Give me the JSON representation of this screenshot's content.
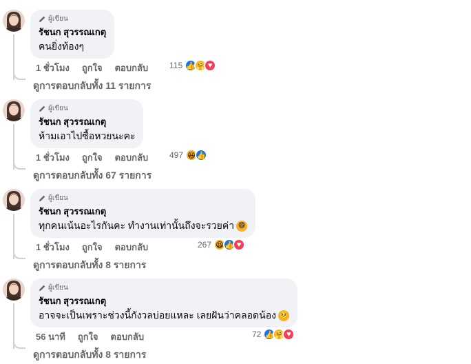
{
  "author_badge": "ผู้เขียน",
  "author_name": "รัชนก สุวรรณเกตุ",
  "like_label": "ถูกใจ",
  "reply_label": "ตอบกลับ",
  "comments": [
    {
      "text": "คนยิ่งท้องๆ",
      "time": "1 ชั่วโมง",
      "reaction_count": "115",
      "reactions": [
        "like-icon",
        "care-icon",
        "love-icon"
      ],
      "view_replies": "ดูการตอบกลับทั้ง 11 รายการ",
      "trailing_emoji": ""
    },
    {
      "text": "ห้ามเอาไปซื้อหวยนะคะ",
      "time": "1 ชั่วโมง",
      "reaction_count": "497",
      "reactions": [
        "haha-icon",
        "like-icon"
      ],
      "view_replies": "ดูการตอบกลับทั้ง 67 รายการ",
      "trailing_emoji": ""
    },
    {
      "text": "ทุกคนเน้นอะไรกันคะ ทำงานเท่านั้นถึงจะรวยค่า",
      "time": "1 ชั่วโมง",
      "reaction_count": "267",
      "reactions": [
        "haha-icon",
        "like-icon",
        "love-icon"
      ],
      "view_replies": "ดูการตอบกลับทั้ง 8 รายการ",
      "trailing_emoji": "grinning-emoji"
    },
    {
      "text": "อาจจะเป็นเพราะช่วงนี้กังวลบ่อยแหละ เลยฝันว่าคลอดน้อง",
      "time": "56 นาที",
      "reaction_count": "72",
      "reactions": [
        "like-icon",
        "care-icon",
        "love-icon"
      ],
      "view_replies": "ดูการตอบกลับทั้ง 8 รายการ",
      "trailing_emoji": "pleading-emoji"
    }
  ],
  "colors": {
    "bubble": "#f0f2f5",
    "secondary_text": "#65676b",
    "like": "#1b74e4",
    "love": "#f33e58",
    "haha": "#f7b125"
  }
}
